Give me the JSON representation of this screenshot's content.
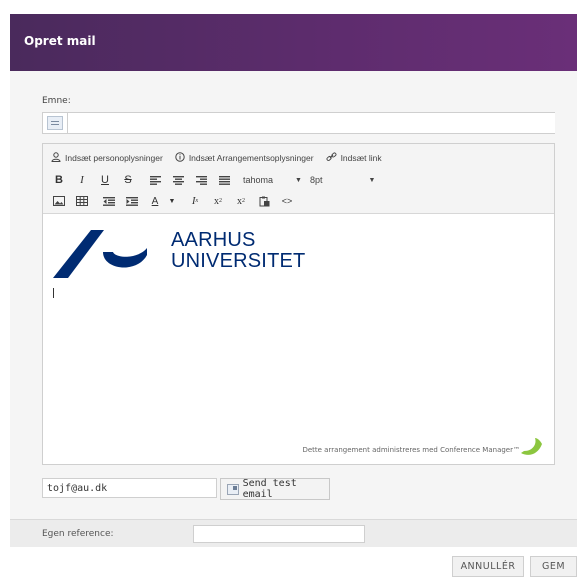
{
  "dialog": {
    "title": "Opret mail"
  },
  "subject": {
    "label": "Emne:",
    "value": ""
  },
  "toolbar": {
    "insert_personal": "Indsæt personoplysninger",
    "insert_event": "Indsæt Arrangementsoplysninger",
    "insert_link": "Indsæt link",
    "bold": "B",
    "italic": "I",
    "underline": "U",
    "strikethrough": "S",
    "font_family": "tahoma",
    "font_size": "8pt"
  },
  "content": {
    "logo_line1": "AARHUS",
    "logo_line2": "UNIVERSITET",
    "footer_note": "Dette arrangement administreres med Conference Manager™"
  },
  "test": {
    "email_value": "tojf@au.dk",
    "send_label": "Send test email"
  },
  "reference": {
    "label": "Egen reference:",
    "value": ""
  },
  "actions": {
    "cancel_label": "ANNULLÉR",
    "save_label": "GEM"
  },
  "colors": {
    "header": "#5d2c6d",
    "au_blue": "#002b72",
    "cm_green": "#8cc63f"
  }
}
